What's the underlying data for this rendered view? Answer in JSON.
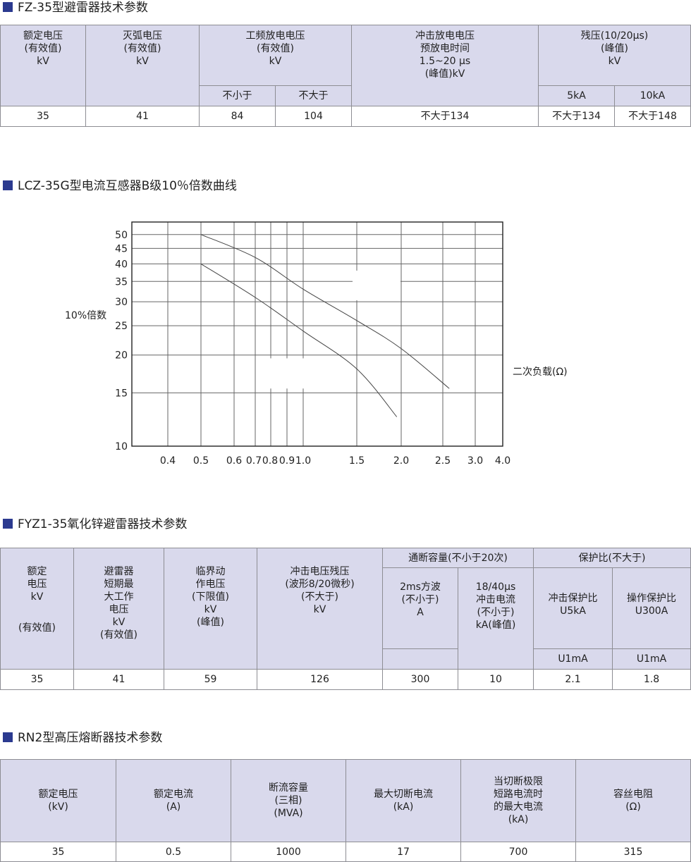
{
  "colors": {
    "header_bg": "#d9d9ec",
    "border": "#8d8d93",
    "title_square": "#2b3a8f"
  },
  "sec1": {
    "title": "FZ-35型避雷器技术参数",
    "h": {
      "c1": [
        "额定电压",
        "(有效值)",
        "kV"
      ],
      "c2": [
        "灭弧电压",
        "(有效值)",
        "kV"
      ],
      "c3": [
        "工频放电电压",
        "(有效值)",
        "kV"
      ],
      "c3a": "不小于",
      "c3b": "不大于",
      "c4": [
        "冲击放电电压",
        "预放电时间",
        "1.5~20 μs",
        "(峰值)kV"
      ],
      "c5": [
        "残压(10/20μs)",
        "(峰值)",
        "kV"
      ],
      "c5a": "5kA",
      "c5b": "10kA"
    },
    "row": [
      "35",
      "41",
      "84",
      "104",
      "不大于134",
      "不大于134",
      "不大于148"
    ]
  },
  "sec2": {
    "title": "LCZ-35G型电流互感器B级10％倍数曲线",
    "chart_data": {
      "type": "line",
      "ylabel": "10%倍数",
      "xlabel": "二次负载(Ω)",
      "x_ticks": [
        "0.4",
        "0.5",
        "0.6",
        "0.7",
        "0.8",
        "0.9",
        "1.0",
        "1.5",
        "2.0",
        "2.5",
        "3.0",
        "4.0"
      ],
      "y_ticks": [
        "10",
        "15",
        "20",
        "25",
        "30",
        "35",
        "40",
        "45",
        "50"
      ],
      "xlim": [
        0.4,
        4.0
      ],
      "ylim": [
        10,
        55
      ],
      "series": [
        {
          "points": [
            [
              0.5,
              50
            ],
            [
              0.7,
              42
            ],
            [
              1.0,
              33
            ],
            [
              1.5,
              26
            ],
            [
              2.0,
              21
            ],
            [
              2.6,
              15.5
            ]
          ]
        },
        {
          "points": [
            [
              0.5,
              40
            ],
            [
              0.7,
              31
            ],
            [
              1.0,
              24
            ],
            [
              1.5,
              18
            ],
            [
              1.95,
              12.5
            ]
          ]
        }
      ]
    }
  },
  "sec3": {
    "title": "FYZ1-35氧化锌避雷器技术参数",
    "h": {
      "c1": [
        "额定",
        "电压",
        "kV"
      ],
      "c1b": "(有效值)",
      "c2": [
        "避雷器",
        "短期最",
        "大工作",
        "电压",
        "kV",
        "(有效值)"
      ],
      "c3": [
        "临界动",
        "作电压",
        "(下限值)",
        "kV",
        "(峰值)"
      ],
      "c4": [
        "冲击电压残压",
        "(波形8/20微秒)",
        "(不大于)",
        "kV"
      ],
      "g1": "通断容量(不小于20次)",
      "c5": [
        "2ms方波",
        "(不小于)",
        "A"
      ],
      "c6": [
        "18/40μs",
        "冲击电流",
        "(不小于)",
        "kA(峰值)"
      ],
      "g2": "保护比(不大于)",
      "c7": [
        "冲击保护比",
        "U5kA"
      ],
      "c7b": "U1mA",
      "c8": [
        "操作保护比",
        "U300A"
      ],
      "c8b": "U1mA"
    },
    "row": [
      "35",
      "41",
      "59",
      "126",
      "300",
      "10",
      "2.1",
      "1.8"
    ]
  },
  "sec4": {
    "title": "RN2型高压熔断器技术参数",
    "h": {
      "c1": [
        "额定电压",
        "(kV)"
      ],
      "c2": [
        "额定电流",
        "(A)"
      ],
      "c3": [
        "断流容量",
        "(三相)",
        "(MVA)"
      ],
      "c4": [
        "最大切断电流",
        "(kA)"
      ],
      "c5": [
        "当切断极限",
        "短路电流时",
        "的最大电流",
        "(kA)"
      ],
      "c6": [
        "容丝电阻",
        "(Ω)"
      ]
    },
    "row": [
      "35",
      "0.5",
      "1000",
      "17",
      "700",
      "315"
    ]
  }
}
